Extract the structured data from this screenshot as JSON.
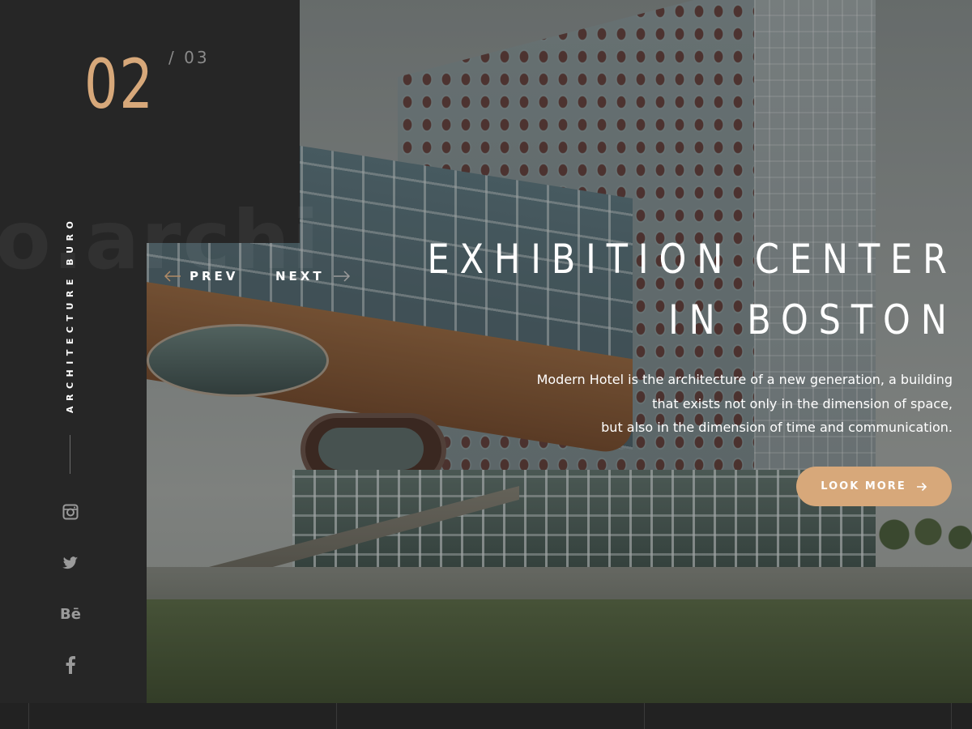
{
  "slider": {
    "current": "02",
    "total": "/  03"
  },
  "brand": {
    "vertical_label": "ARCHITECTURE BURO",
    "background_word": "o.archi"
  },
  "navigation": {
    "prev_label": "PREV",
    "next_label": "NEXT",
    "prev_icon": "arrow-left-icon",
    "next_icon": "arrow-right-icon"
  },
  "slide": {
    "title_line1": "EXHIBITION CENTER",
    "title_line2": "IN BOSTON",
    "description_lines": [
      "Modern Hotel is the architecture of a new generation, a building",
      "that exists not only in the dimension of space,",
      "but also in the dimension of time and communication."
    ],
    "cta_label": "LOOK MORE",
    "cta_icon": "arrow-right-icon"
  },
  "social": [
    {
      "name": "instagram-icon"
    },
    {
      "name": "twitter-icon"
    },
    {
      "name": "behance-icon",
      "glyph": "Bē"
    },
    {
      "name": "facebook-icon"
    }
  ],
  "colors": {
    "accent": "#d7a87a",
    "sidebar": "#262626",
    "text": "#ffffff",
    "muted": "#8a8a8a"
  }
}
